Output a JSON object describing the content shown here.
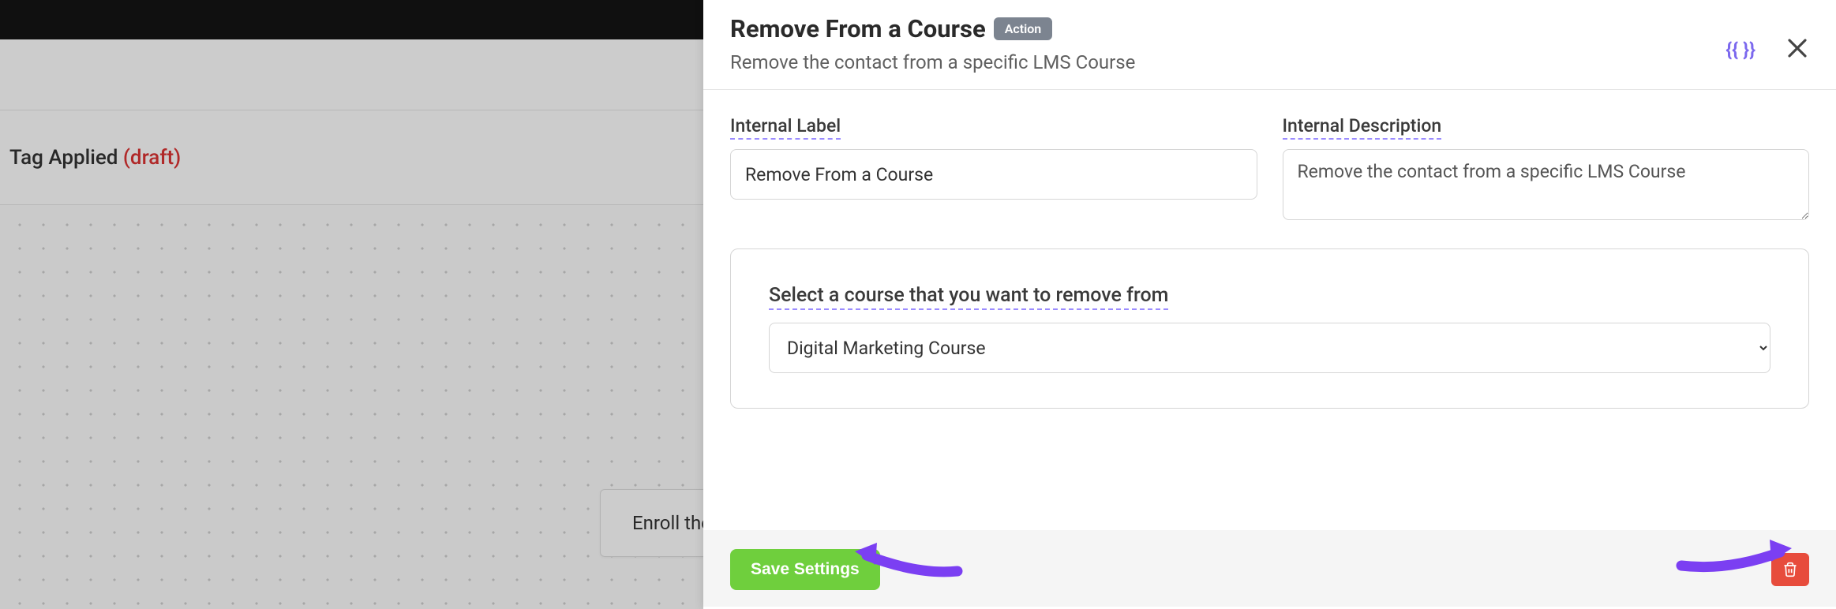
{
  "bg": {
    "tag_label": "Tag Applied",
    "draft_label": "(draft)",
    "node_text": "Enroll the"
  },
  "panel": {
    "title": "Remove From a Course",
    "badge": "Action",
    "subtitle": "Remove the contact from a specific LMS Course",
    "merge_tag": "{{ }}"
  },
  "form": {
    "label_internal": "Internal Label",
    "label_description": "Internal Description",
    "value_internal": "Remove From a Course",
    "value_description": "Remove the contact from a specific LMS Course",
    "select_label": "Select a course that you want to remove from",
    "select_value": "Digital Marketing Course"
  },
  "footer": {
    "save_label": "Save Settings"
  },
  "colors": {
    "accent_purple": "#7b68ee",
    "underline_purple": "#9b8cff",
    "save_green": "#6fcf3d",
    "delete_red": "#e74c3c",
    "draft_red": "#d33"
  }
}
